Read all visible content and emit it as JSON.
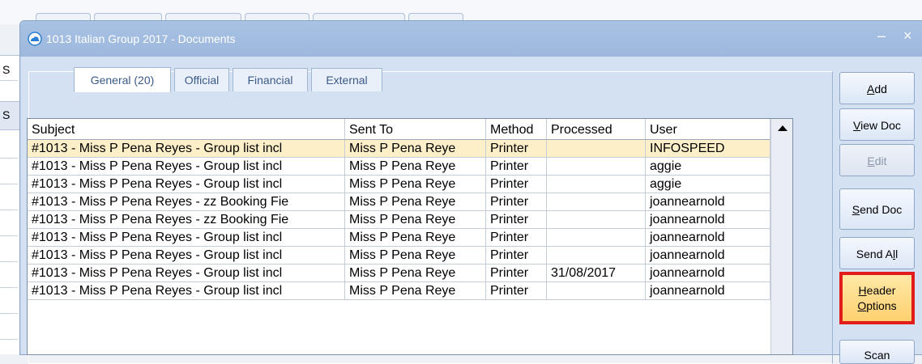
{
  "window": {
    "title": "1013 Italian Group 2017 - Documents",
    "minimize_glyph": "–",
    "close_glyph": "×"
  },
  "background": {
    "left_labels": [
      "S",
      "S"
    ]
  },
  "tabs": [
    {
      "label": "General (20)",
      "active": true
    },
    {
      "label": "Official",
      "active": false
    },
    {
      "label": "Financial",
      "active": false
    },
    {
      "label": "External",
      "active": false
    }
  ],
  "grid": {
    "columns": [
      "Subject",
      "Sent To",
      "Method",
      "Processed",
      "User"
    ],
    "rows": [
      {
        "subject": "#1013 - Miss P Pena Reyes - Group list incl",
        "sent_to": "Miss P Pena Reye",
        "method": "Printer",
        "processed": "",
        "user": "INFOSPEED",
        "selected": true
      },
      {
        "subject": "#1013 - Miss P Pena Reyes - Group list incl",
        "sent_to": "Miss P Pena Reye",
        "method": "Printer",
        "processed": "",
        "user": "aggie",
        "selected": false
      },
      {
        "subject": "#1013 - Miss P Pena Reyes - Group list incl",
        "sent_to": "Miss P Pena Reye",
        "method": "Printer",
        "processed": "",
        "user": "aggie",
        "selected": false
      },
      {
        "subject": "#1013 - Miss P Pena Reyes - zz Booking Fie",
        "sent_to": "Miss P Pena Reye",
        "method": "Printer",
        "processed": "",
        "user": "joannearnold",
        "selected": false
      },
      {
        "subject": "#1013 - Miss P Pena Reyes - zz Booking Fie",
        "sent_to": "Miss P Pena Reye",
        "method": "Printer",
        "processed": "",
        "user": "joannearnold",
        "selected": false
      },
      {
        "subject": "#1013 - Miss P Pena Reyes - Group list incl",
        "sent_to": "Miss P Pena Reye",
        "method": "Printer",
        "processed": "",
        "user": "joannearnold",
        "selected": false
      },
      {
        "subject": "#1013 - Miss P Pena Reyes - Group list incl",
        "sent_to": "Miss P Pena Reye",
        "method": "Printer",
        "processed": "",
        "user": "joannearnold",
        "selected": false
      },
      {
        "subject": "#1013 - Miss P Pena Reyes - Group list incl",
        "sent_to": "Miss P Pena Reye",
        "method": "Printer",
        "processed": "31/08/2017",
        "user": "joannearnold",
        "selected": false
      },
      {
        "subject": "#1013 - Miss P Pena Reyes - Group list incl",
        "sent_to": "Miss P Pena Reye",
        "method": "Printer",
        "processed": "",
        "user": "joannearnold",
        "selected": false
      }
    ]
  },
  "buttons": {
    "add": {
      "mnemonic": "A",
      "rest": "dd"
    },
    "view_doc": {
      "mnemonic": "V",
      "rest": "iew Doc"
    },
    "edit": {
      "mnemonic": "E",
      "rest": "dit"
    },
    "send_doc": {
      "mnemonic": "S",
      "rest": "end Doc"
    },
    "send_all": {
      "pre": "Send A",
      "mnemonic": "l",
      "rest": "l"
    },
    "header_options": {
      "line1_mnemonic": "H",
      "line1_rest": "eader",
      "line2_mnemonic": "O",
      "line2_rest": "ptions"
    },
    "scan": {
      "label": "Scan"
    }
  },
  "colors": {
    "selected_row": "#fdefc7",
    "highlight_border": "#e21b1b",
    "highlight_fill": "#ffd071",
    "tab_text": "#3c5a86"
  }
}
